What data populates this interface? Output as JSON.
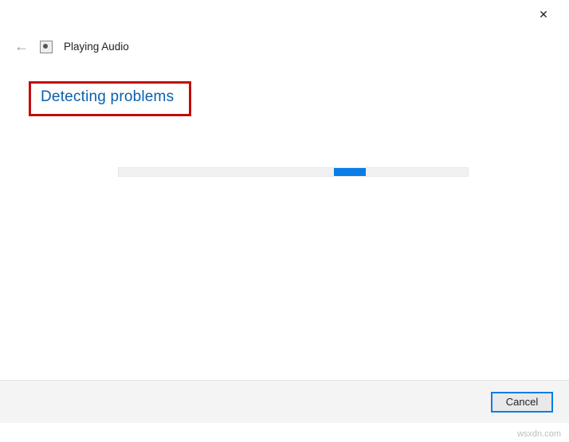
{
  "window": {
    "title": "Playing Audio",
    "close_glyph": "✕"
  },
  "content": {
    "status_heading": "Detecting problems"
  },
  "footer": {
    "cancel_label": "Cancel"
  },
  "watermark": "wsxdn.com",
  "colors": {
    "accent": "#0a7de6",
    "heading": "#0a5fae",
    "highlight_border": "#c30b0b"
  }
}
